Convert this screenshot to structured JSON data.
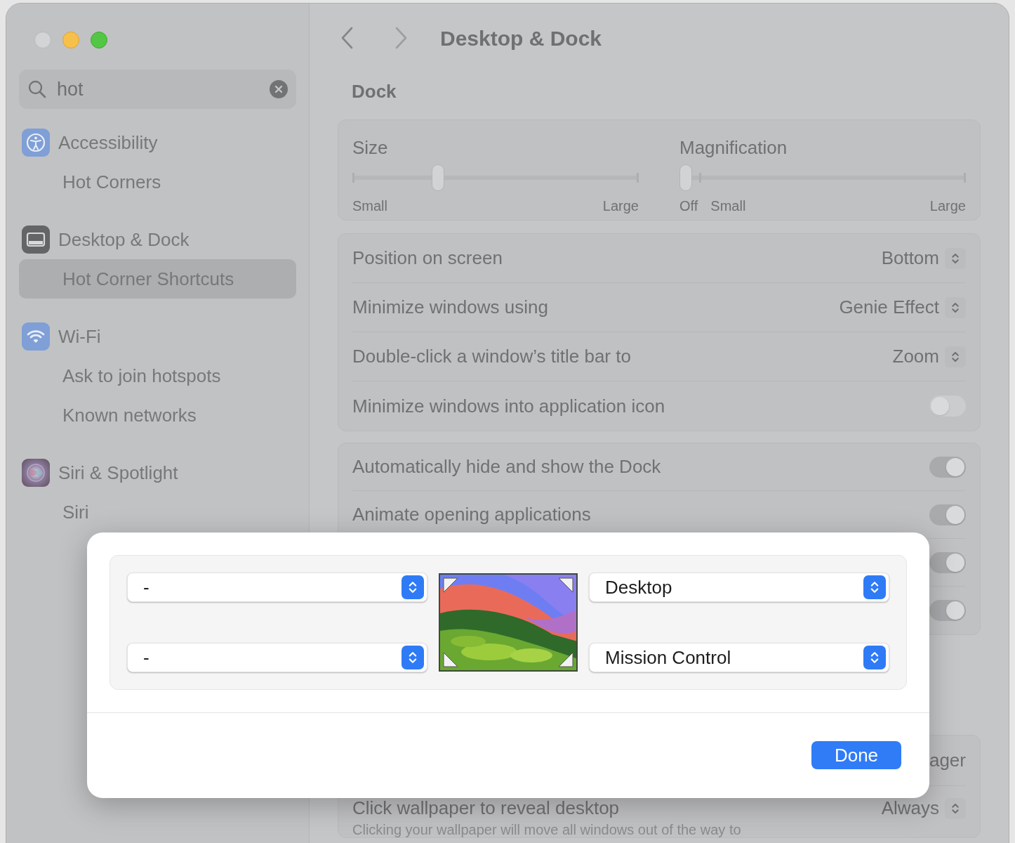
{
  "window": {
    "title": "Desktop & Dock"
  },
  "search": {
    "value": "hot"
  },
  "sidebar": {
    "groups": [
      {
        "label": "Accessibility",
        "children": [
          {
            "label": "Hot Corners",
            "selected": false
          }
        ]
      },
      {
        "label": "Desktop & Dock",
        "children": [
          {
            "label": "Hot Corner Shortcuts",
            "selected": true
          }
        ]
      },
      {
        "label": "Wi-Fi",
        "children": [
          {
            "label": "Ask to join hotspots",
            "selected": false
          },
          {
            "label": "Known networks",
            "selected": false
          }
        ]
      },
      {
        "label": "Siri & Spotlight",
        "children": [
          {
            "label": "Siri",
            "selected": false
          }
        ]
      }
    ]
  },
  "section_title": "Dock",
  "sliders": [
    {
      "label": "Size",
      "level": 0.29,
      "tick_labels": [
        "Small",
        "Large"
      ]
    },
    {
      "label": "Magnification",
      "level": 0,
      "tick_labels": [
        "Off",
        "Small",
        "Large"
      ]
    }
  ],
  "dock_options": [
    {
      "label": "Position on screen",
      "value": "Bottom"
    },
    {
      "label": "Minimize windows using",
      "value": "Genie Effect"
    },
    {
      "label": "Double-click a window’s title bar to",
      "value": "Zoom"
    },
    {
      "label": "Minimize windows into application icon",
      "on": false
    }
  ],
  "dock_toggles": [
    {
      "label": "Automatically hide and show the Dock",
      "on": true
    },
    {
      "label": "Animate opening applications",
      "on": true
    },
    {
      "on": true
    },
    {
      "on": true
    }
  ],
  "desktop_rows": [
    {
      "label_fragment": "ager"
    },
    {
      "label": "Click wallpaper to reveal desktop",
      "value": "Always",
      "description": "Clicking your wallpaper will move all windows out of the way to"
    }
  ],
  "hot_corners_sheet": {
    "top_left": "-",
    "bottom_left": "-",
    "top_right": "Desktop",
    "bottom_right": "Mission Control",
    "done_button": "Done"
  }
}
